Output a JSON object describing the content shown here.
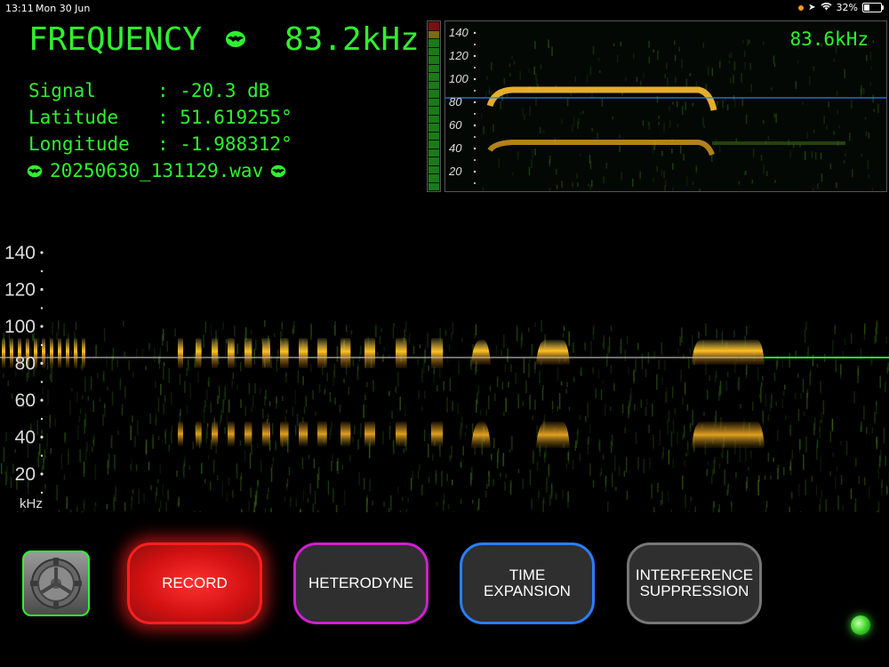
{
  "status_bar": {
    "time": "13:11",
    "date": "Mon 30 Jun",
    "battery": "32%"
  },
  "header": {
    "frequency_label": "FREQUENCY",
    "frequency_value": "83.2kHz"
  },
  "info": {
    "signal_label": "Signal",
    "signal_value": ": -20.3 dB",
    "latitude_label": "Latitude",
    "latitude_value": ": 51.619255°",
    "longitude_label": "Longitude",
    "longitude_value": ": -1.988312°",
    "filename": "20250630_131129.wav"
  },
  "mini_spectrogram": {
    "readout": "83.6kHz",
    "ticks": [
      "140",
      "120",
      "100",
      "80",
      "60",
      "40",
      "20"
    ]
  },
  "main_spectrogram": {
    "ticks": [
      "140",
      "120",
      "100",
      "80",
      "60",
      "40",
      "20"
    ],
    "unit": "kHz"
  },
  "buttons": {
    "record": "RECORD",
    "heterodyne": "HETERODYNE",
    "time_expansion_1": "TIME",
    "time_expansion_2": "EXPANSION",
    "interference_1": "INTERFERENCE",
    "interference_2": "SUPPRESSION"
  },
  "colors": {
    "accent": "#2ef22e",
    "record": "#ff2020",
    "heterodyne": "#d020d0",
    "time_expansion": "#2a7fff",
    "interference": "#888888"
  }
}
